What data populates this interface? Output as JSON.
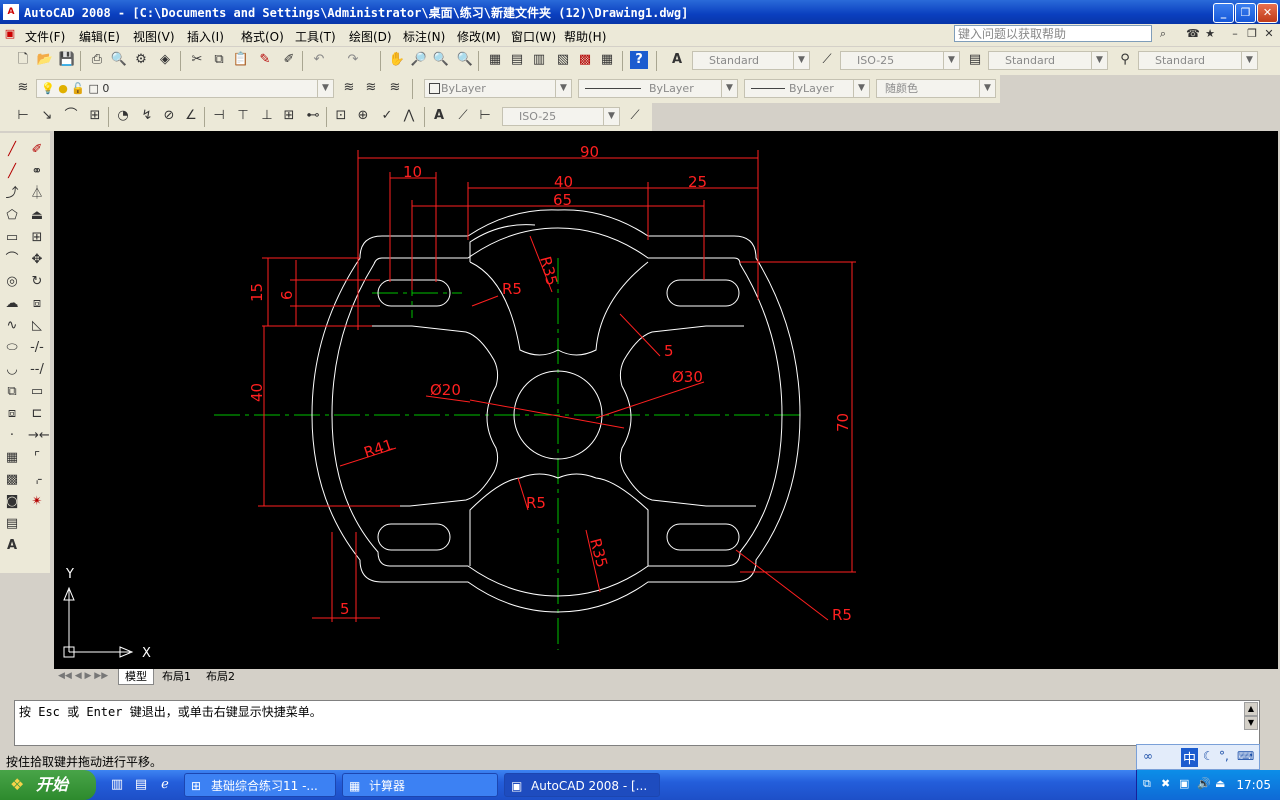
{
  "window": {
    "title": "AutoCAD 2008 - [C:\\Documents and Settings\\Administrator\\桌面\\练习\\新建文件夹 (12)\\Drawing1.dwg]",
    "app_icon": "A",
    "buttons": {
      "minimize": "_",
      "restore": "❐",
      "close": "✕"
    }
  },
  "menubar": {
    "items": [
      "文件(F)",
      "编辑(E)",
      "视图(V)",
      "插入(I)",
      "格式(O)",
      "工具(T)",
      "绘图(D)",
      "标注(N)",
      "修改(M)",
      "窗口(W)",
      "帮助(H)"
    ],
    "help_placeholder": "键入问题以获取帮助"
  },
  "toolbar_styles": {
    "text_style": "Standard",
    "dim_style": "ISO-25",
    "table_style": "Standard",
    "multileader_style": "Standard"
  },
  "toolbar_layers": {
    "layer": "0",
    "color": "ByLayer",
    "linetype": "ByLayer",
    "lineweight": "ByLayer",
    "plotstyle": "随颜色"
  },
  "toolbar_dim": {
    "dim_style": "ISO-25"
  },
  "drawing": {
    "dimensions": {
      "d90": "90",
      "d10": "10",
      "d40_top": "40",
      "d25": "25",
      "d65": "65",
      "r35_top": "R35",
      "r5_slot": "R5",
      "d15": "15",
      "d6": "6",
      "d5_diag": "5",
      "dia30": "Ø30",
      "dia20": "Ø20",
      "d40_left": "40",
      "d70": "70",
      "r41": "R41",
      "r5_bottom": "R5",
      "r35_bottom": "R35",
      "d5_bottom": "5",
      "r5_corner": "R5"
    },
    "ucs": {
      "x": "X",
      "y": "Y"
    },
    "colors": {
      "background": "#000000",
      "outline": "#ffffff",
      "dimension": "#ff2020",
      "center": "#00c000"
    }
  },
  "layout_tabs": [
    "模型",
    "布局1",
    "布局2"
  ],
  "command": {
    "line1": "按 Esc 或 Enter 键退出，或单击右键显示快捷菜单。"
  },
  "status": {
    "text": "按住拾取键并拖动进行平移。"
  },
  "taskbar": {
    "start": "开始",
    "tasks": [
      "基础综合练习11 -...",
      "计算器",
      "AutoCAD 2008 - [..."
    ],
    "clock": "17:05"
  }
}
